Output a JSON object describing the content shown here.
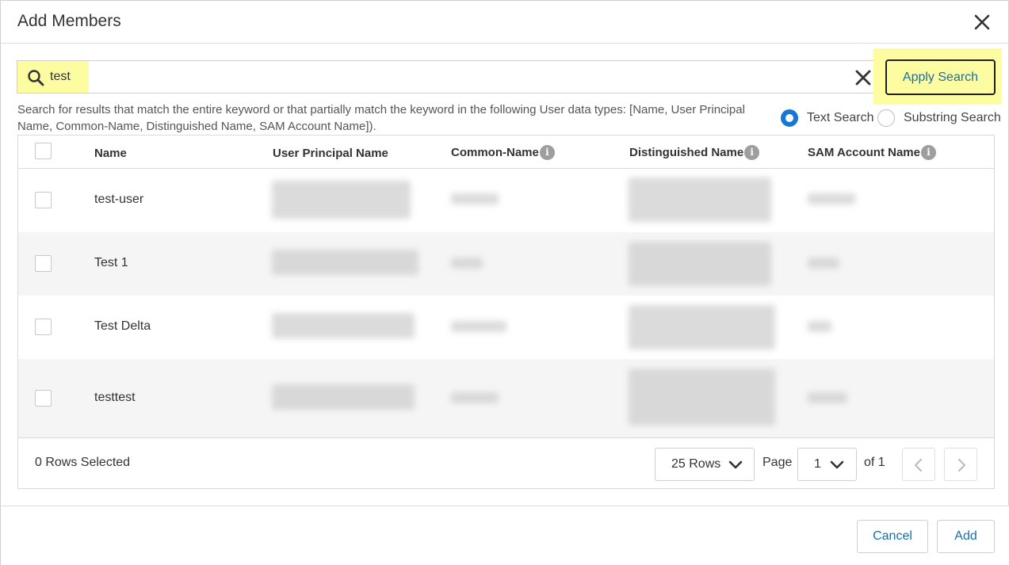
{
  "dialog": {
    "title": "Add Members"
  },
  "search": {
    "value": "test",
    "placeholder": "",
    "apply_label": "Apply Search",
    "hint": "Search for results that match the entire keyword or that partially match the keyword in the following User data types: [Name, User Principal Name, Common-Name, Distinguished Name, SAM Account Name]).",
    "modes": [
      {
        "label": "Text Search",
        "selected": true
      },
      {
        "label": "Substring Search",
        "selected": false
      }
    ],
    "highlight_color": "#fdfca0"
  },
  "table": {
    "columns": [
      {
        "label": "Name",
        "info": false
      },
      {
        "label": "User Principal Name",
        "info": false
      },
      {
        "label": "Common-Name",
        "info": true
      },
      {
        "label": "Distinguished Name",
        "info": true
      },
      {
        "label": "SAM Account Name",
        "info": true
      }
    ],
    "rows": [
      {
        "name": "test-user"
      },
      {
        "name": "Test 1"
      },
      {
        "name": "Test Delta"
      },
      {
        "name": "testtest"
      }
    ],
    "info_glyph": "i"
  },
  "pagination": {
    "rows_selected": "0 Rows Selected",
    "rows_per_page": "25 Rows",
    "page_label": "Page",
    "current_page": "1",
    "of_pages": "of 1"
  },
  "footer": {
    "cancel_label": "Cancel",
    "add_label": "Add"
  },
  "colors": {
    "accent": "#1976d2",
    "link": "#1a6ea6"
  }
}
